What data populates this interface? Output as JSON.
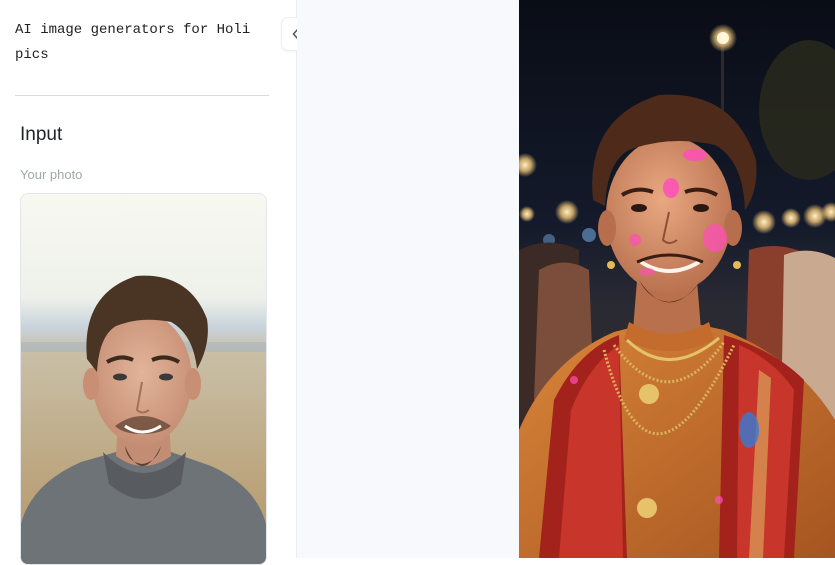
{
  "sidebar": {
    "title": "AI image generators for Holi pics",
    "section_heading": "Input",
    "photo_label": "Your photo"
  },
  "colors": {
    "accent_pink": "#ff4fb8",
    "sidebar_bg": "#ffffff",
    "main_bg": "#f8f9fc"
  },
  "icons": {
    "collapse": "double-chevron-left-icon"
  }
}
